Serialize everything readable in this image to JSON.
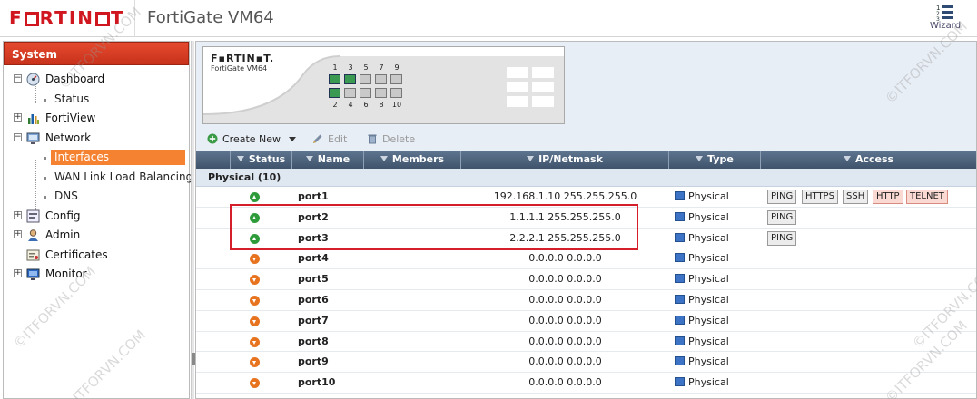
{
  "header": {
    "logo_text": "F▪RTIN▪T",
    "app_title": "FortiGate VM64",
    "wizard_label": "Wizard",
    "watermark": "©ITFORVN.COM"
  },
  "sidebar": {
    "title": "System",
    "dashboard": {
      "label": "Dashboard",
      "children": [
        {
          "label": "Status"
        }
      ]
    },
    "fortiview": {
      "label": "FortiView"
    },
    "network": {
      "label": "Network",
      "children": [
        {
          "label": "Interfaces"
        },
        {
          "label": "WAN Link Load Balancing"
        },
        {
          "label": "DNS"
        }
      ]
    },
    "config": {
      "label": "Config"
    },
    "admin": {
      "label": "Admin"
    },
    "certificates": {
      "label": "Certificates"
    },
    "monitor": {
      "label": "Monitor"
    }
  },
  "device": {
    "logo_text": "F▪RTIN▪T.",
    "model": "FortiGate VM64",
    "ports_top": [
      "1",
      "3",
      "5",
      "7",
      "9"
    ],
    "ports_bottom": [
      "2",
      "4",
      "6",
      "8",
      "10"
    ],
    "ports_up": [
      "1",
      "2",
      "3"
    ]
  },
  "toolbar": {
    "create_new": "Create New",
    "edit": "Edit",
    "delete": "Delete"
  },
  "grid": {
    "columns": {
      "status": "Status",
      "name": "Name",
      "members": "Members",
      "ip": "IP/Netmask",
      "type": "Type",
      "access": "Access"
    },
    "group_label": "Physical (10)",
    "rows": [
      {
        "status": "up",
        "name": "port1",
        "ip": "192.168.1.10 255.255.255.0",
        "type": "Physical",
        "access": [
          {
            "t": "PING",
            "red": false
          },
          {
            "t": "HTTPS",
            "red": false
          },
          {
            "t": "SSH",
            "red": false
          },
          {
            "t": "HTTP",
            "red": true
          },
          {
            "t": "TELNET",
            "red": true
          }
        ]
      },
      {
        "status": "up",
        "name": "port2",
        "ip": "1.1.1.1 255.255.255.0",
        "type": "Physical",
        "access": [
          {
            "t": "PING",
            "red": false
          }
        ]
      },
      {
        "status": "up",
        "name": "port3",
        "ip": "2.2.2.1 255.255.255.0",
        "type": "Physical",
        "access": [
          {
            "t": "PING",
            "red": false
          }
        ]
      },
      {
        "status": "down",
        "name": "port4",
        "ip": "0.0.0.0 0.0.0.0",
        "type": "Physical",
        "access": []
      },
      {
        "status": "down",
        "name": "port5",
        "ip": "0.0.0.0 0.0.0.0",
        "type": "Physical",
        "access": []
      },
      {
        "status": "down",
        "name": "port6",
        "ip": "0.0.0.0 0.0.0.0",
        "type": "Physical",
        "access": []
      },
      {
        "status": "down",
        "name": "port7",
        "ip": "0.0.0.0 0.0.0.0",
        "type": "Physical",
        "access": []
      },
      {
        "status": "down",
        "name": "port8",
        "ip": "0.0.0.0 0.0.0.0",
        "type": "Physical",
        "access": []
      },
      {
        "status": "down",
        "name": "port9",
        "ip": "0.0.0.0 0.0.0.0",
        "type": "Physical",
        "access": []
      },
      {
        "status": "down",
        "name": "port10",
        "ip": "0.0.0.0 0.0.0.0",
        "type": "Physical",
        "access": []
      }
    ]
  },
  "colors": {
    "accent_orange": "#f58230",
    "header_red": "#d0161e",
    "status_up": "#2e9b3a",
    "status_down": "#e8731f",
    "highlight_box": "#d41f2b"
  }
}
